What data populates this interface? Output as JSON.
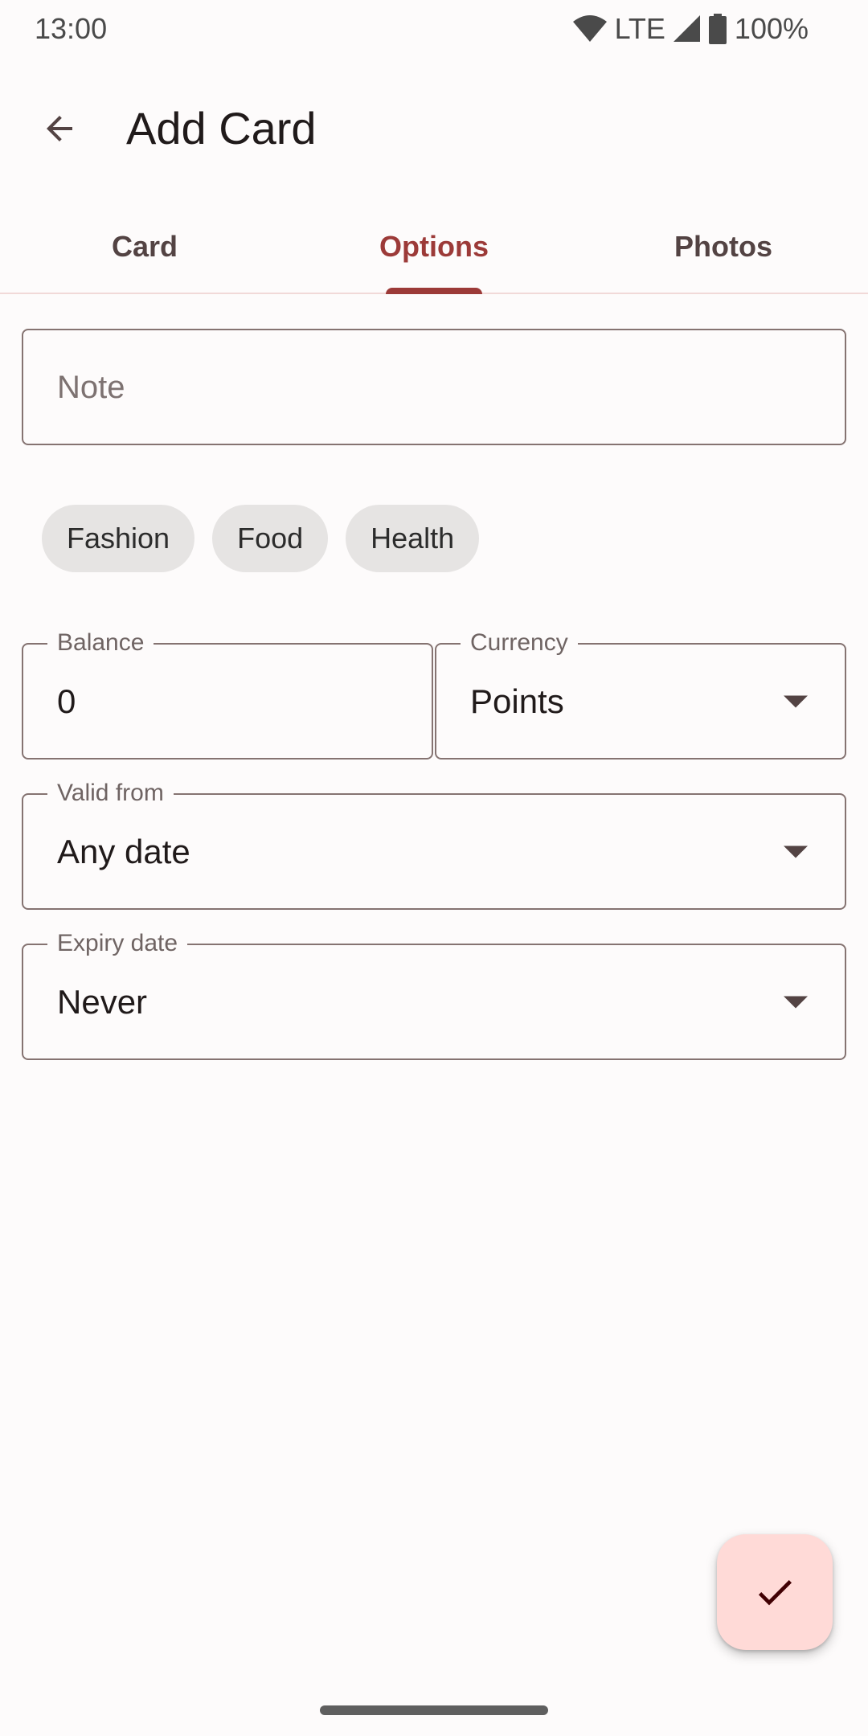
{
  "status_bar": {
    "time": "13:00",
    "network": "LTE",
    "battery": "100%",
    "icons": [
      "wifi-icon",
      "cell-signal-icon",
      "battery-icon"
    ]
  },
  "app_bar": {
    "title": "Add Card",
    "back_icon": "arrow-back-icon"
  },
  "tabs": [
    {
      "label": "Card",
      "active": false
    },
    {
      "label": "Options",
      "active": true
    },
    {
      "label": "Photos",
      "active": false
    }
  ],
  "form": {
    "note": {
      "placeholder": "Note",
      "value": ""
    },
    "groups": [
      "Fashion",
      "Food",
      "Health"
    ],
    "balance": {
      "label": "Balance",
      "value": "0"
    },
    "currency": {
      "label": "Currency",
      "value": "Points"
    },
    "valid_from": {
      "label": "Valid from",
      "value": "Any date"
    },
    "expiry_date": {
      "label": "Expiry date",
      "value": "Never"
    }
  },
  "fab": {
    "icon": "check-icon"
  },
  "colors": {
    "accent": "#9c3a38",
    "fab_bg": "#ffdad7",
    "chip_bg": "#e6e4e3",
    "background": "#fdfbfb"
  }
}
